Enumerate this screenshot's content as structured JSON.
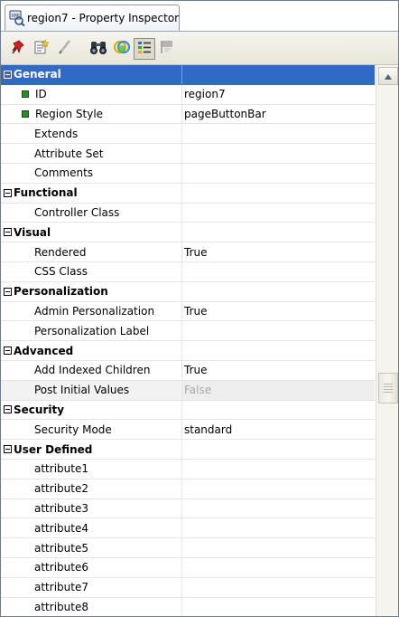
{
  "window": {
    "tab_title": "region7 - Property Inspector"
  },
  "toolbar": {
    "buttons": [
      {
        "icon": "pushpin-icon"
      },
      {
        "icon": "edit-properties-icon"
      },
      {
        "icon": "pencil-icon"
      },
      {
        "icon": "binoculars-icon"
      },
      {
        "icon": "color-circles-icon"
      },
      {
        "icon": "categorized-view-icon",
        "active": true
      },
      {
        "icon": "flag-icon"
      }
    ]
  },
  "grid": {
    "sections": [
      {
        "name": "General",
        "selected": true,
        "rows": [
          {
            "label": "ID",
            "value": "region7",
            "required": true
          },
          {
            "label": "Region Style",
            "value": "pageButtonBar",
            "required": true
          },
          {
            "label": "Extends",
            "value": ""
          },
          {
            "label": "Attribute Set",
            "value": ""
          },
          {
            "label": "Comments",
            "value": ""
          }
        ]
      },
      {
        "name": "Functional",
        "rows": [
          {
            "label": "Controller Class",
            "value": ""
          }
        ]
      },
      {
        "name": "Visual",
        "rows": [
          {
            "label": "Rendered",
            "value": "True"
          },
          {
            "label": "CSS Class",
            "value": ""
          }
        ]
      },
      {
        "name": "Personalization",
        "rows": [
          {
            "label": "Admin Personalization",
            "value": "True"
          },
          {
            "label": "Personalization Label",
            "value": ""
          }
        ]
      },
      {
        "name": "Advanced",
        "rows": [
          {
            "label": "Add Indexed Children",
            "value": "True"
          },
          {
            "label": "Post Initial Values",
            "value": "False",
            "disabled": true
          }
        ]
      },
      {
        "name": "Security",
        "rows": [
          {
            "label": "Security Mode",
            "value": "standard"
          }
        ]
      },
      {
        "name": "User Defined",
        "rows": [
          {
            "label": "attribute1",
            "value": ""
          },
          {
            "label": "attribute2",
            "value": ""
          },
          {
            "label": "attribute3",
            "value": ""
          },
          {
            "label": "attribute4",
            "value": ""
          },
          {
            "label": "attribute5",
            "value": ""
          },
          {
            "label": "attribute6",
            "value": ""
          },
          {
            "label": "attribute7",
            "value": ""
          },
          {
            "label": "attribute8",
            "value": ""
          }
        ]
      }
    ]
  },
  "colors": {
    "selection": "#3169c6",
    "required_marker": "#2c8a2a",
    "disabled_text": "#a8a8a8"
  }
}
